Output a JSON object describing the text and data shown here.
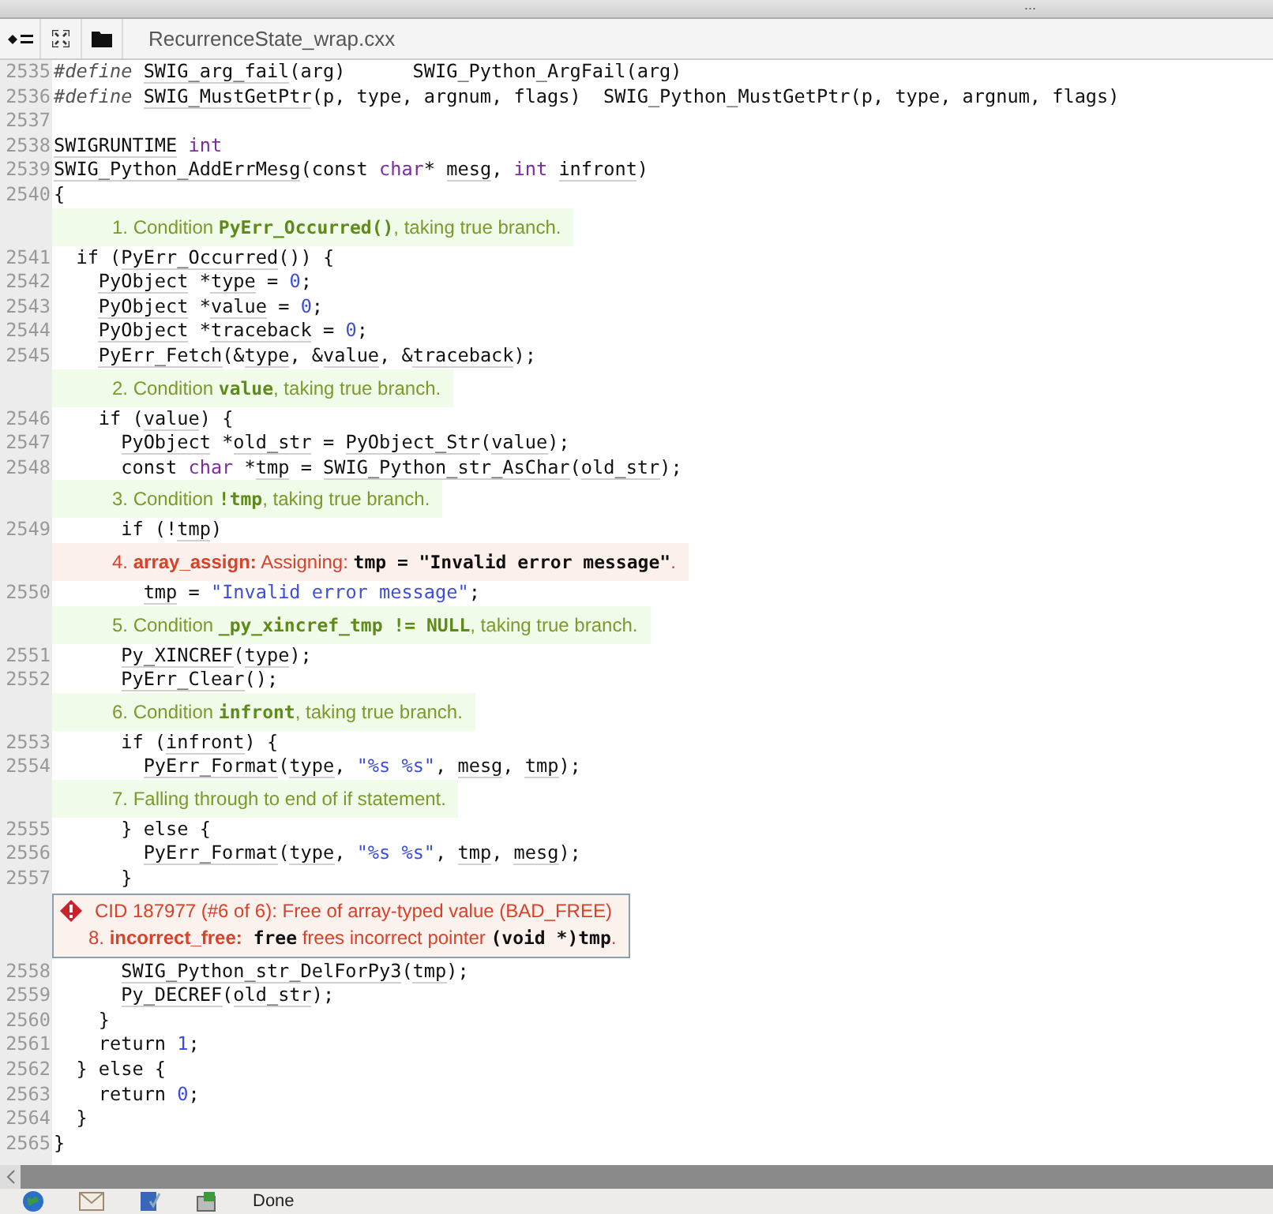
{
  "top_strip": {
    "grip": "..."
  },
  "tab": {
    "title": "RecurrenceState_wrap.cxx"
  },
  "rows": [
    {
      "kind": "code",
      "number": "2535",
      "tokens": [
        {
          "kind": "directive",
          "text": "#define "
        },
        {
          "kind": "link",
          "text": "SWIG_arg_fail"
        },
        {
          "kind": "plain",
          "text": "(arg)      SWIG_Python_ArgFail(arg)"
        }
      ]
    },
    {
      "kind": "code",
      "number": "2536",
      "tokens": [
        {
          "kind": "directive",
          "text": "#define "
        },
        {
          "kind": "link",
          "text": "SWIG_MustGetPtr"
        },
        {
          "kind": "plain",
          "text": "(p, type, argnum, flags)  SWIG_Python_MustGetPtr(p, type, argnum, flags)"
        }
      ]
    },
    {
      "kind": "code",
      "number": "2537",
      "tokens": []
    },
    {
      "kind": "code",
      "number": "2538",
      "tokens": [
        {
          "kind": "link",
          "text": "SWIGRUNTIME "
        },
        {
          "kind": "keyword",
          "text": "int"
        }
      ]
    },
    {
      "kind": "code",
      "number": "2539",
      "tokens": [
        {
          "kind": "link",
          "text": "SWIG_Python_AddErrMesg"
        },
        {
          "kind": "plain",
          "text": "(const "
        },
        {
          "kind": "keyword",
          "text": "char"
        },
        {
          "kind": "plain",
          "text": "* "
        },
        {
          "kind": "link",
          "text": "mesg"
        },
        {
          "kind": "plain",
          "text": ", "
        },
        {
          "kind": "keyword",
          "text": "int "
        },
        {
          "kind": "link",
          "text": "infront"
        },
        {
          "kind": "plain",
          "text": ")"
        }
      ]
    },
    {
      "kind": "code",
      "number": "2540",
      "tokens": [
        {
          "kind": "plain",
          "text": "{"
        }
      ]
    },
    {
      "kind": "note",
      "parts": [
        {
          "kind": "plain",
          "text": "1. Condition "
        },
        {
          "kind": "code",
          "text": "PyErr_Occurred()"
        },
        {
          "kind": "plain",
          "text": ", taking true branch."
        }
      ]
    },
    {
      "kind": "code",
      "number": "2541",
      "tokens": [
        {
          "kind": "plain",
          "text": "  if ("
        },
        {
          "kind": "link",
          "text": "PyErr_Occurred"
        },
        {
          "kind": "plain",
          "text": "()) {"
        }
      ]
    },
    {
      "kind": "code",
      "number": "2542",
      "tokens": [
        {
          "kind": "link",
          "text": "    PyObject"
        },
        {
          "kind": "plain",
          "text": " *"
        },
        {
          "kind": "link",
          "text": "type"
        },
        {
          "kind": "plain",
          "text": " = "
        },
        {
          "kind": "literal",
          "text": "0"
        },
        {
          "kind": "plain",
          "text": ";"
        }
      ]
    },
    {
      "kind": "code",
      "number": "2543",
      "tokens": [
        {
          "kind": "link",
          "text": "    PyObject"
        },
        {
          "kind": "plain",
          "text": " *"
        },
        {
          "kind": "link",
          "text": "value"
        },
        {
          "kind": "plain",
          "text": " = "
        },
        {
          "kind": "literal",
          "text": "0"
        },
        {
          "kind": "plain",
          "text": ";"
        }
      ]
    },
    {
      "kind": "code",
      "number": "2544",
      "tokens": [
        {
          "kind": "link",
          "text": "    PyObject"
        },
        {
          "kind": "plain",
          "text": " *"
        },
        {
          "kind": "link",
          "text": "traceback"
        },
        {
          "kind": "plain",
          "text": " = "
        },
        {
          "kind": "literal",
          "text": "0"
        },
        {
          "kind": "plain",
          "text": ";"
        }
      ]
    },
    {
      "kind": "code",
      "number": "2545",
      "tokens": [
        {
          "kind": "link",
          "text": "    PyErr_Fetch"
        },
        {
          "kind": "plain",
          "text": "(&"
        },
        {
          "kind": "link",
          "text": "type"
        },
        {
          "kind": "plain",
          "text": ", &"
        },
        {
          "kind": "link",
          "text": "value"
        },
        {
          "kind": "plain",
          "text": ", &"
        },
        {
          "kind": "link",
          "text": "traceback"
        },
        {
          "kind": "plain",
          "text": ");"
        }
      ]
    },
    {
      "kind": "note",
      "parts": [
        {
          "kind": "plain",
          "text": "2. Condition "
        },
        {
          "kind": "code",
          "text": "value"
        },
        {
          "kind": "plain",
          "text": ", taking true branch."
        }
      ]
    },
    {
      "kind": "code",
      "number": "2546",
      "tokens": [
        {
          "kind": "plain",
          "text": "    if ("
        },
        {
          "kind": "link",
          "text": "value"
        },
        {
          "kind": "plain",
          "text": ") {"
        }
      ]
    },
    {
      "kind": "code",
      "number": "2547",
      "tokens": [
        {
          "kind": "link",
          "text": "      PyObject"
        },
        {
          "kind": "plain",
          "text": " *"
        },
        {
          "kind": "link",
          "text": "old_str"
        },
        {
          "kind": "plain",
          "text": " = "
        },
        {
          "kind": "link",
          "text": "PyObject_Str"
        },
        {
          "kind": "plain",
          "text": "("
        },
        {
          "kind": "link",
          "text": "value"
        },
        {
          "kind": "plain",
          "text": ");"
        }
      ]
    },
    {
      "kind": "code",
      "number": "2548",
      "tokens": [
        {
          "kind": "plain",
          "text": "      const "
        },
        {
          "kind": "keyword",
          "text": "char"
        },
        {
          "kind": "plain",
          "text": " *"
        },
        {
          "kind": "link",
          "text": "tmp"
        },
        {
          "kind": "plain",
          "text": " = "
        },
        {
          "kind": "link",
          "text": "SWIG_Python_str_AsChar"
        },
        {
          "kind": "plain",
          "text": "("
        },
        {
          "kind": "link",
          "text": "old_str"
        },
        {
          "kind": "plain",
          "text": ");"
        }
      ]
    },
    {
      "kind": "note",
      "parts": [
        {
          "kind": "plain",
          "text": "3. Condition "
        },
        {
          "kind": "code",
          "text": "!tmp"
        },
        {
          "kind": "plain",
          "text": ", taking true branch."
        }
      ]
    },
    {
      "kind": "code",
      "number": "2549",
      "tokens": [
        {
          "kind": "plain",
          "text": "      if (!"
        },
        {
          "kind": "link",
          "text": "tmp"
        },
        {
          "kind": "plain",
          "text": ")"
        }
      ]
    },
    {
      "kind": "warning",
      "parts": [
        {
          "kind": "plain",
          "text": "4. "
        },
        {
          "kind": "tag",
          "text": "array_assign:"
        },
        {
          "kind": "plain",
          "text": " Assigning: "
        },
        {
          "kind": "code",
          "text": "tmp = \"Invalid error message\""
        },
        {
          "kind": "plain",
          "text": "."
        }
      ]
    },
    {
      "kind": "code",
      "number": "2550",
      "tokens": [
        {
          "kind": "link",
          "text": "        tmp"
        },
        {
          "kind": "plain",
          "text": " = "
        },
        {
          "kind": "literal",
          "text": "\"Invalid error message\""
        },
        {
          "kind": "plain",
          "text": ";"
        }
      ]
    },
    {
      "kind": "note",
      "parts": [
        {
          "kind": "plain",
          "text": "5. Condition "
        },
        {
          "kind": "code",
          "text": "_py_xincref_tmp != NULL"
        },
        {
          "kind": "plain",
          "text": ", taking true branch."
        }
      ]
    },
    {
      "kind": "code",
      "number": "2551",
      "tokens": [
        {
          "kind": "link",
          "text": "      Py_XINCREF"
        },
        {
          "kind": "plain",
          "text": "("
        },
        {
          "kind": "link",
          "text": "type"
        },
        {
          "kind": "plain",
          "text": ");"
        }
      ]
    },
    {
      "kind": "code",
      "number": "2552",
      "tokens": [
        {
          "kind": "link",
          "text": "      PyErr_Clear"
        },
        {
          "kind": "plain",
          "text": "();"
        }
      ]
    },
    {
      "kind": "note",
      "parts": [
        {
          "kind": "plain",
          "text": "6. Condition "
        },
        {
          "kind": "code",
          "text": "infront"
        },
        {
          "kind": "plain",
          "text": ", taking true branch."
        }
      ]
    },
    {
      "kind": "code",
      "number": "2553",
      "tokens": [
        {
          "kind": "plain",
          "text": "      if ("
        },
        {
          "kind": "link",
          "text": "infront"
        },
        {
          "kind": "plain",
          "text": ") {"
        }
      ]
    },
    {
      "kind": "code",
      "number": "2554",
      "tokens": [
        {
          "kind": "link",
          "text": "        PyErr_Format"
        },
        {
          "kind": "plain",
          "text": "("
        },
        {
          "kind": "link",
          "text": "type"
        },
        {
          "kind": "plain",
          "text": ", "
        },
        {
          "kind": "literal",
          "text": "\"%s %s\""
        },
        {
          "kind": "plain",
          "text": ", "
        },
        {
          "kind": "link",
          "text": "mesg"
        },
        {
          "kind": "plain",
          "text": ", "
        },
        {
          "kind": "link",
          "text": "tmp"
        },
        {
          "kind": "plain",
          "text": ");"
        }
      ]
    },
    {
      "kind": "note",
      "parts": [
        {
          "kind": "plain",
          "text": "7. Falling through to end of if statement."
        }
      ]
    },
    {
      "kind": "code",
      "number": "2555",
      "tokens": [
        {
          "kind": "plain",
          "text": "      } else {"
        }
      ]
    },
    {
      "kind": "code",
      "number": "2556",
      "tokens": [
        {
          "kind": "link",
          "text": "        PyErr_Format"
        },
        {
          "kind": "plain",
          "text": "("
        },
        {
          "kind": "link",
          "text": "type"
        },
        {
          "kind": "plain",
          "text": ", "
        },
        {
          "kind": "literal",
          "text": "\"%s %s\""
        },
        {
          "kind": "plain",
          "text": ", "
        },
        {
          "kind": "link",
          "text": "tmp"
        },
        {
          "kind": "plain",
          "text": ", "
        },
        {
          "kind": "link",
          "text": "mesg"
        },
        {
          "kind": "plain",
          "text": ");"
        }
      ]
    },
    {
      "kind": "code",
      "number": "2557",
      "tokens": [
        {
          "kind": "plain",
          "text": "      }"
        }
      ]
    },
    {
      "kind": "defect",
      "title": "CID 187977 (#6 of 6): Free of array-typed value (BAD_FREE)",
      "parts": [
        {
          "kind": "plain",
          "text": "8. "
        },
        {
          "kind": "tag",
          "text": "incorrect_free:"
        },
        {
          "kind": "code",
          "text": " free"
        },
        {
          "kind": "plain",
          "text": " frees incorrect pointer "
        },
        {
          "kind": "code",
          "text": "(void *)tmp"
        },
        {
          "kind": "plain",
          "text": "."
        }
      ]
    },
    {
      "kind": "code",
      "number": "2558",
      "tokens": [
        {
          "kind": "link",
          "text": "      SWIG_Python_str_DelForPy3"
        },
        {
          "kind": "plain",
          "text": "("
        },
        {
          "kind": "link",
          "text": "tmp"
        },
        {
          "kind": "plain",
          "text": ");"
        }
      ]
    },
    {
      "kind": "code",
      "number": "2559",
      "tokens": [
        {
          "kind": "link",
          "text": "      Py_DECREF"
        },
        {
          "kind": "plain",
          "text": "("
        },
        {
          "kind": "link",
          "text": "old_str"
        },
        {
          "kind": "plain",
          "text": ");"
        }
      ]
    },
    {
      "kind": "code",
      "number": "2560",
      "tokens": [
        {
          "kind": "plain",
          "text": "    }"
        }
      ]
    },
    {
      "kind": "code",
      "number": "2561",
      "tokens": [
        {
          "kind": "plain",
          "text": "    return "
        },
        {
          "kind": "literal",
          "text": "1"
        },
        {
          "kind": "plain",
          "text": ";"
        }
      ]
    },
    {
      "kind": "code",
      "number": "2562",
      "tokens": [
        {
          "kind": "plain",
          "text": "  } else {"
        }
      ]
    },
    {
      "kind": "code",
      "number": "2563",
      "tokens": [
        {
          "kind": "plain",
          "text": "    return "
        },
        {
          "kind": "literal",
          "text": "0"
        },
        {
          "kind": "plain",
          "text": ";"
        }
      ]
    },
    {
      "kind": "code",
      "number": "2564",
      "tokens": [
        {
          "kind": "plain",
          "text": "  }"
        }
      ]
    },
    {
      "kind": "code",
      "number": "2565",
      "tokens": [
        {
          "kind": "plain",
          "text": "}"
        }
      ]
    }
  ],
  "status_bar": {
    "text": "Done"
  }
}
